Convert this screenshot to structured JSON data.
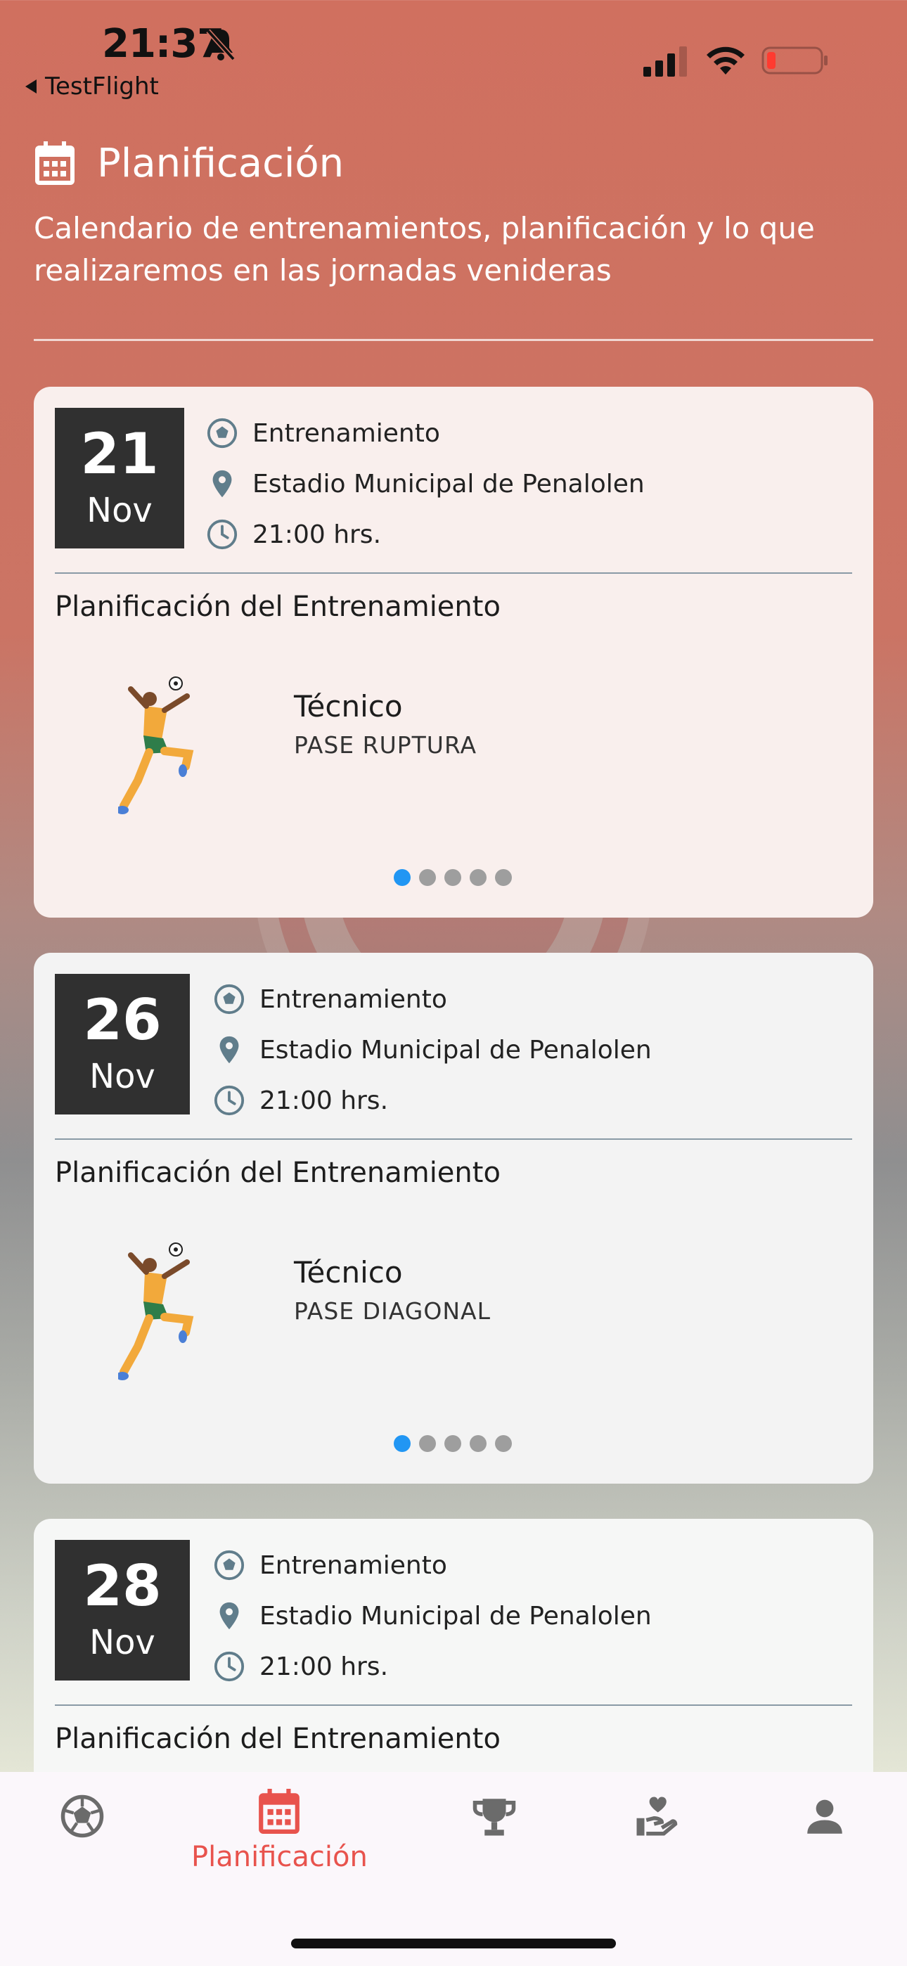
{
  "status_bar": {
    "time": "21:37",
    "back_app": "TestFlight"
  },
  "header": {
    "title": "Planificación",
    "subtitle": "Calendario de entrenamientos, planificación y lo que realizaremos en las jornadas venideras"
  },
  "cards": [
    {
      "day": "21",
      "month": "Nov",
      "type": "Entrenamiento",
      "location": "Estadio  Municipal de Penalolen",
      "time": "21:00 hrs.",
      "plan_title": "Planificación del Entrenamiento",
      "drill_category": "Técnico",
      "drill_name": "PASE RUPTURA",
      "page_count": 5,
      "active_page": 0
    },
    {
      "day": "26",
      "month": "Nov",
      "type": "Entrenamiento",
      "location": "Estadio  Municipal de Penalolen",
      "time": "21:00 hrs.",
      "plan_title": "Planificación del Entrenamiento",
      "drill_category": "Técnico",
      "drill_name": "PASE DIAGONAL",
      "page_count": 5,
      "active_page": 0
    },
    {
      "day": "28",
      "month": "Nov",
      "type": "Entrenamiento",
      "location": "Estadio  Municipal de Penalolen",
      "time": "21:00 hrs.",
      "plan_title": "Planificación del Entrenamiento"
    }
  ],
  "bottom_nav": {
    "items": [
      {
        "icon": "soccer-ball-icon",
        "label": ""
      },
      {
        "icon": "calendar-icon",
        "label": "Planificación",
        "active": true
      },
      {
        "icon": "trophy-icon",
        "label": ""
      },
      {
        "icon": "hand-heart-icon",
        "label": ""
      },
      {
        "icon": "person-icon",
        "label": ""
      }
    ]
  },
  "colors": {
    "accent": "#e8534d",
    "active_dot": "#2196f3",
    "date_box": "#303030"
  }
}
